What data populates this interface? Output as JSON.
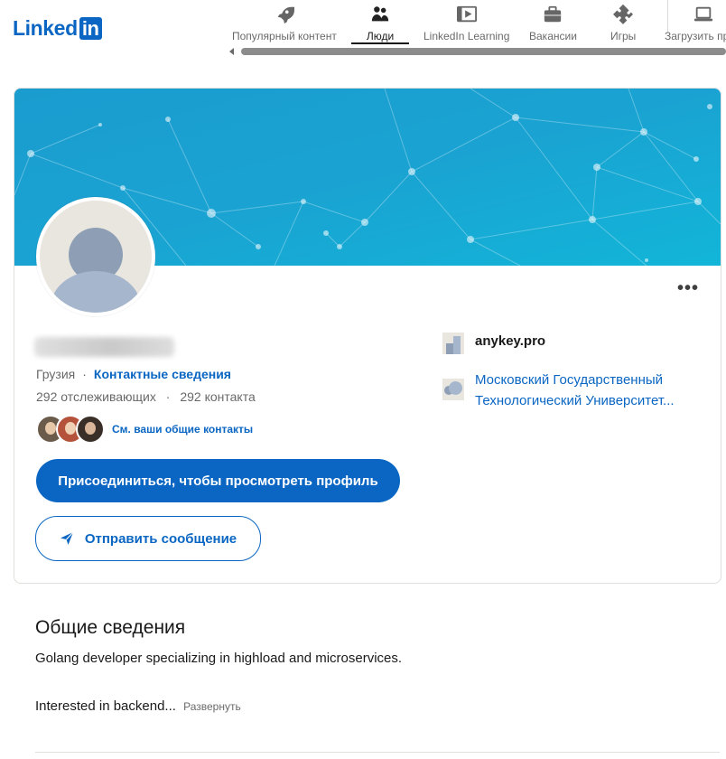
{
  "header": {
    "logo": {
      "text": "Linked",
      "box_text": "in",
      "color": "#0a66c2"
    },
    "nav": [
      {
        "label": "Популярный контент",
        "icon": "rocket-icon",
        "active": false
      },
      {
        "label": "Люди",
        "icon": "people-icon",
        "active": true
      },
      {
        "label": "LinkedIn Learning",
        "icon": "video-play-icon",
        "active": false
      },
      {
        "label": "Вакансии",
        "icon": "briefcase-icon",
        "active": false
      },
      {
        "label": "Игры",
        "icon": "puzzle-icon",
        "active": false
      },
      {
        "label": "Загрузить прил",
        "icon": "laptop-icon",
        "active": false
      }
    ]
  },
  "profile": {
    "cover_color": "#1a9ccf",
    "location": "Грузия",
    "separator": "·",
    "contact_info_link": "Контактные сведения",
    "followers": "292 отслеживающих",
    "connections": "292 контакта",
    "mutual_contacts_link": "См. ваши общие контакты",
    "primary_button": "Присоединиться, чтобы просмотреть профиль",
    "secondary_button": "Отправить сообщение",
    "more_button": "•••",
    "company": "anykey.pro",
    "education": [
      "Московский Государственный",
      "Технологический Университет..."
    ]
  },
  "about": {
    "title": "Общие сведения",
    "text": "Golang developer specializing in highload and microservices.",
    "more_text": "Interested in backend...",
    "expand": "Развернуть"
  },
  "colors": {
    "accent": "#0a66c2",
    "cover": "#1a9ccf"
  }
}
